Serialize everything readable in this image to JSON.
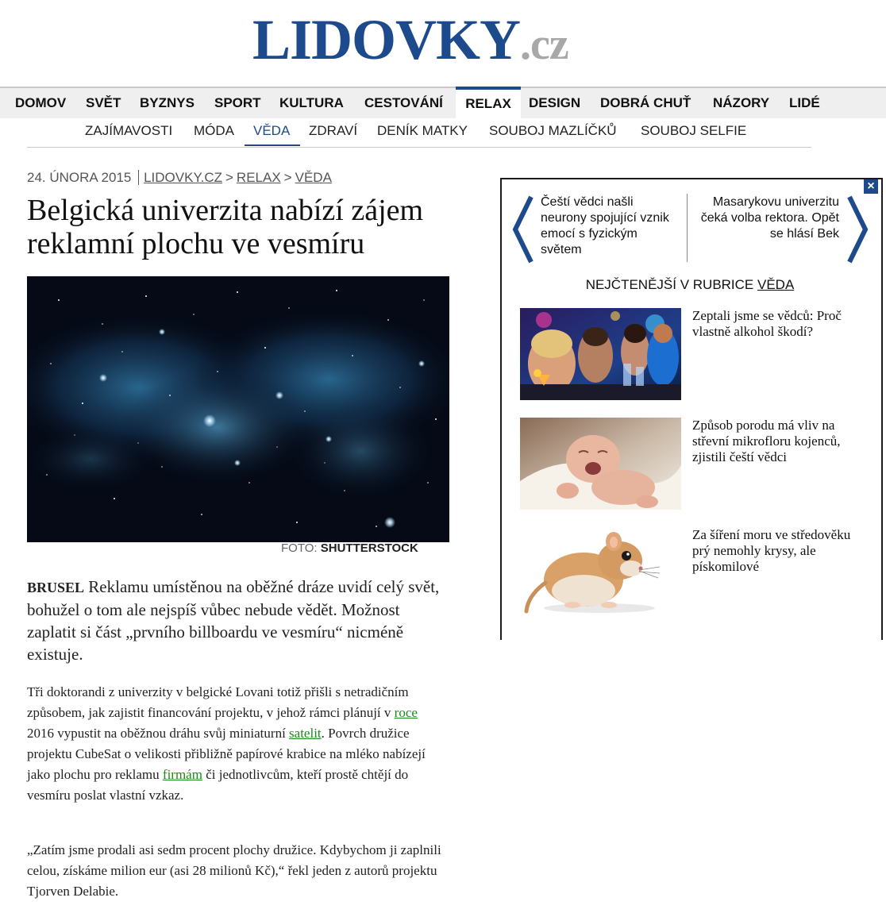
{
  "site": {
    "logo_name": "LIDOVKY",
    "logo_tld": ".cz"
  },
  "nav": {
    "main": [
      "DOMOV",
      "SVĚT",
      "BYZNYS",
      "SPORT",
      "KULTURA",
      "CESTOVÁNÍ",
      "RELAX",
      "DESIGN",
      "DOBRÁ CHUŤ",
      "NÁZORY",
      "LIDÉ"
    ],
    "main_active": "RELAX",
    "sub": [
      "ZAJÍMAVOSTI",
      "MÓDA",
      "VĚDA",
      "ZDRAVÍ",
      "DENÍK MATKY",
      "SOUBOJ MAZLÍČKŮ",
      "SOUBOJ SELFIE"
    ],
    "sub_active": "VĚDA"
  },
  "breadcrumb": {
    "date": "24. ÚNORA 2015",
    "items": [
      "LIDOVKY.CZ",
      "RELAX",
      "VĚDA"
    ],
    "separator": ">"
  },
  "article": {
    "headline_line1": "Belgická univerzita nabízí zájem",
    "headline_line2": "reklamní plochu ve vesmíru",
    "photo_caption_label": "FOTO:",
    "photo_caption_source": "SHUTTERSTOCK",
    "lead_place": "BRUSEL",
    "lead_text": " Reklamu umístěnou na oběžné dráze uvidí celý svět, bohužel o tom ale nejspíš vůbec nebude vědět. Možnost zaplatit si část „prvního billboardu ve vesmíru“ nicméně existuje.",
    "p1": {
      "t1": "Tři doktorandi z univerzity v belgické Lovani totiž přišli s netradičním způsobem, jak zajistit financování projektu, v jehož rámci plánují v ",
      "link1": "roce",
      "t2": " 2016 vypustit na oběžnou dráhu svůj miniaturní ",
      "link2": "satelit",
      "t3": ". Povrch družice projektu CubeSat o velikosti přibližně papírové krabice na mléko nabízejí jako plochu pro reklamu ",
      "link3": "firmám",
      "t4": " či jednotlivcům, kteří prostě chtějí do vesmíru poslat vlastní vzkaz."
    },
    "p2": "„Zatím jsme prodali asi sedm procent plochy družice. Kdybychom ji zaplnili celou, získáme milion eur (asi 28 milionů Kč),“ řekl jeden z autorů projektu Tjorven Delabie."
  },
  "panel": {
    "close_glyph": "×",
    "prev_title": "Čeští vědci našli neurony spojující vznik emocí s fyzickým světem",
    "next_title": "Masarykovu univerzitu čeká volba rektora. Opět se hlásí Bek",
    "rubrika_prefix": "NEJČTENĚJŠÍ V RUBRICE ",
    "rubrika_name": "VĚDA",
    "cards": [
      {
        "title": "Zeptali jsme se vědců: Proč vlastně alkohol škodí?",
        "image": "bar-party-photo"
      },
      {
        "title": "Způsob porodu má vliv na střevní mikrofloru kojenců, zjistili čeští vědci",
        "image": "crying-baby-photo"
      },
      {
        "title": "Za šíření moru ve středověku prý nemohly krysy, ale pískomilové",
        "image": "gerbil-photo"
      }
    ]
  },
  "colors": {
    "brand": "#1d4a8c",
    "link_green": "#1a8a1a",
    "tld_gray": "#a8a8a8"
  }
}
